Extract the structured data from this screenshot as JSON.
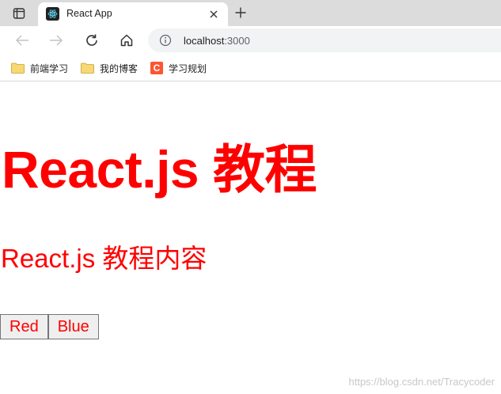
{
  "browser": {
    "tab": {
      "title": "React App",
      "favicon": "react-logo-icon"
    },
    "address_bar": {
      "host": "localhost",
      "port": ":3000"
    },
    "bookmarks": [
      {
        "label": "前端学习",
        "icon": "folder-icon"
      },
      {
        "label": "我的博客",
        "icon": "folder-icon"
      },
      {
        "label": "学习规划",
        "icon": "csdn-icon",
        "icon_text": "C"
      }
    ]
  },
  "page": {
    "heading": "React.js 教程",
    "subheading": "React.js 教程内容",
    "buttons": [
      {
        "label": "Red"
      },
      {
        "label": "Blue"
      }
    ],
    "text_color": "#ff0000"
  },
  "watermark": "https://blog.csdn.net/Tracycoder"
}
